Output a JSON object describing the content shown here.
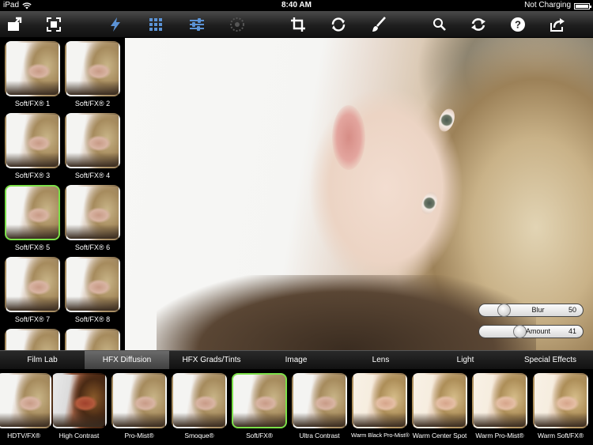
{
  "status": {
    "carrier": "iPad",
    "time": "8:40 AM",
    "battery_text": "Not Charging"
  },
  "toolbar": {
    "icons": [
      "open-image-icon",
      "fit-screen-icon",
      "filters-lightning-icon",
      "grid-icon",
      "adjust-sliders-icon",
      "spot-icon",
      "crop-icon",
      "rotate-icon",
      "brush-icon",
      "magnify-icon",
      "refresh-icon",
      "help-icon",
      "share-icon"
    ],
    "accent": "#5b93d6"
  },
  "left_thumbnails": [
    {
      "label": "Soft/FX® 1",
      "selected": false
    },
    {
      "label": "Soft/FX® 2",
      "selected": false
    },
    {
      "label": "Soft/FX® 3",
      "selected": false
    },
    {
      "label": "Soft/FX® 4",
      "selected": false
    },
    {
      "label": "Soft/FX® 5",
      "selected": true
    },
    {
      "label": "Soft/FX® 6",
      "selected": false
    },
    {
      "label": "Soft/FX® 7",
      "selected": false
    },
    {
      "label": "Soft/FX® 8",
      "selected": false
    },
    {
      "label": "",
      "selected": false
    },
    {
      "label": "",
      "selected": false
    }
  ],
  "sliders": {
    "blur": {
      "label": "Blur",
      "value": "50",
      "level": 0.2
    },
    "amount": {
      "label": "Amount",
      "value": "41",
      "level": 0.37
    }
  },
  "tabs": [
    {
      "label": "Film Lab",
      "active": false
    },
    {
      "label": "HFX Diffusion",
      "active": true
    },
    {
      "label": "HFX Grads/Tints",
      "active": false
    },
    {
      "label": "Image",
      "active": false
    },
    {
      "label": "Lens",
      "active": false
    },
    {
      "label": "Light",
      "active": false
    },
    {
      "label": "Special Effects",
      "active": false
    }
  ],
  "bottom_thumbnails": [
    {
      "label": "HDTV/FX®",
      "selected": false,
      "tone": "normal"
    },
    {
      "label": "High Contrast",
      "selected": false,
      "tone": "dark"
    },
    {
      "label": "Pro-Mist®",
      "selected": false,
      "tone": "normal"
    },
    {
      "label": "Smoque®",
      "selected": false,
      "tone": "normal"
    },
    {
      "label": "Soft/FX®",
      "selected": true,
      "tone": "normal"
    },
    {
      "label": "Ultra Contrast",
      "selected": false,
      "tone": "normal"
    },
    {
      "label": "Warm Black Pro-Mist®",
      "selected": false,
      "tone": "warm"
    },
    {
      "label": "Warm Center Spot",
      "selected": false,
      "tone": "warm"
    },
    {
      "label": "Warm Pro-Mist®",
      "selected": false,
      "tone": "warm"
    },
    {
      "label": "Warm Soft/FX®",
      "selected": false,
      "tone": "warm"
    }
  ]
}
